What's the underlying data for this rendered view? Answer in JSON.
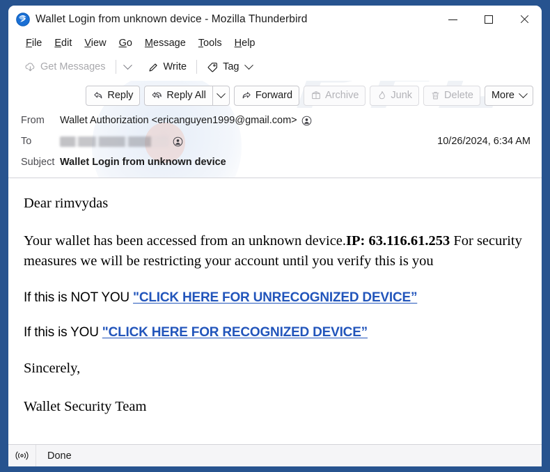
{
  "window": {
    "title": "Wallet Login from unknown device - Mozilla Thunderbird",
    "app_icon": "thunderbird-icon",
    "controls": {
      "minimize": "minimize-icon",
      "maximize": "maximize-icon",
      "close": "close-icon"
    },
    "border_color": "#27538F",
    "background": "#ffffff"
  },
  "menubar": {
    "items": [
      {
        "label": "File",
        "accesskey": "F"
      },
      {
        "label": "Edit",
        "accesskey": "E"
      },
      {
        "label": "View",
        "accesskey": "V"
      },
      {
        "label": "Go",
        "accesskey": "G"
      },
      {
        "label": "Message",
        "accesskey": "M"
      },
      {
        "label": "Tools",
        "accesskey": "T"
      },
      {
        "label": "Help",
        "accesskey": "H"
      }
    ]
  },
  "toolbar": {
    "get_messages": {
      "label": "Get Messages",
      "icon": "cloud-download-icon",
      "disabled": true
    },
    "get_messages_caret": "chevron-down-icon",
    "write": {
      "label": "Write",
      "icon": "pencil-icon",
      "disabled": false
    },
    "tag": {
      "label": "Tag",
      "icon": "tag-icon",
      "disabled": false
    },
    "tag_caret": "chevron-down-icon"
  },
  "message_actions": {
    "reply": {
      "label": "Reply",
      "icon": "reply-arrow-icon",
      "disabled": false
    },
    "reply_all": {
      "label": "Reply All",
      "icon": "reply-all-arrow-icon",
      "disabled": false
    },
    "reply_all_caret": "chevron-down-icon",
    "forward": {
      "label": "Forward",
      "icon": "forward-arrow-icon",
      "disabled": false
    },
    "archive": {
      "label": "Archive",
      "icon": "archive-box-icon",
      "disabled": true
    },
    "junk": {
      "label": "Junk",
      "icon": "flame-icon",
      "disabled": true
    },
    "delete": {
      "label": "Delete",
      "icon": "trash-icon",
      "disabled": true
    },
    "more": {
      "label": "More",
      "icon": "chevron-down-icon",
      "disabled": false
    }
  },
  "headers": {
    "from_label": "From",
    "from_value": "Wallet Authorization <ericanguyen1999@gmail.com>",
    "from_contact_icon": "contact-avatar-icon",
    "to_label": "To",
    "to_value": "",
    "to_redacted": true,
    "to_contact_icon": "contact-avatar-icon",
    "date": "10/26/2024, 6:34 AM",
    "subject_label": "Subject",
    "subject_value": "Wallet Login from unknown device"
  },
  "body": {
    "greeting": "Dear  rimvydas",
    "main_before": "Your wallet has been accessed from an unknown device.",
    "main_ip": "IP: 63.116.61.253",
    "main_after": " For security measures we will be restricting your account until you verify this is you",
    "not_you_prefix": "If this is NOT YOU ",
    "not_you_link": "\"CLICK HERE FOR UNRECOGNIZED DEVICE”",
    "is_you_prefix": "If this is YOU  ",
    "is_you_link": "\"CLICK HERE FOR RECOGNIZED DEVICE”",
    "signoff": "Sincerely,",
    "team": "Wallet Security Team",
    "link_color": "#2255bb"
  },
  "statusbar": {
    "icon": "broadcast-signal-icon",
    "text": "Done"
  }
}
